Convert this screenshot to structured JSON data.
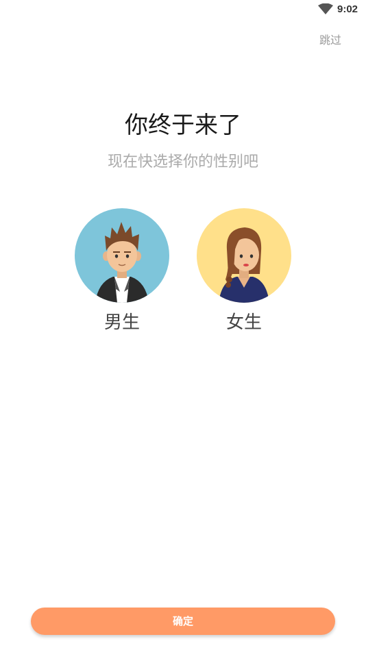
{
  "status_bar": {
    "time": "9:02",
    "wifi_icon": "wifi-icon"
  },
  "header": {
    "skip_label": "跳过"
  },
  "main": {
    "title": "你终于来了",
    "subtitle": "现在快选择你的性别吧"
  },
  "genders": [
    {
      "label": "男生",
      "avatar_icon": "male-avatar-icon",
      "bg_color": "#7ec5da"
    },
    {
      "label": "女生",
      "avatar_icon": "female-avatar-icon",
      "bg_color": "#ffe08a"
    }
  ],
  "footer": {
    "confirm_label": "确定",
    "accent_color": "#ff9a66"
  }
}
